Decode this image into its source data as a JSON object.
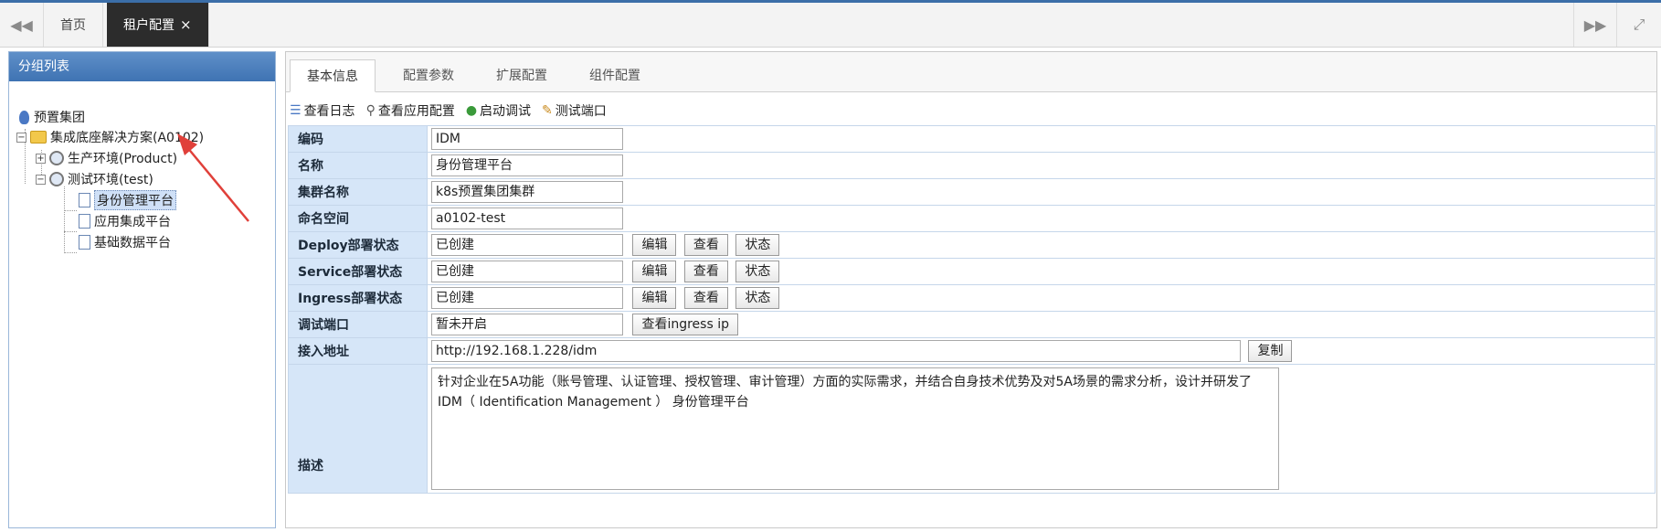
{
  "topbar": {
    "tabs": [
      {
        "label": "首页"
      },
      {
        "label": "租户配置",
        "close": "×"
      }
    ],
    "left_nav_glyph": "◀◀",
    "right_nav_glyph": "▶▶",
    "fullscreen_glyph": "⤢"
  },
  "sidebar": {
    "title": "分组列表",
    "tree": {
      "root": "预置集团",
      "solution": "集成底座解决方案(A0102)",
      "env_product": "生产环境(Product)",
      "env_test": "测试环境(test)",
      "apps": [
        "身份管理平台",
        "应用集成平台",
        "基础数据平台"
      ]
    }
  },
  "content": {
    "tabs": [
      "基本信息",
      "配置参数",
      "扩展配置",
      "组件配置"
    ],
    "toolbar": [
      "查看日志",
      "查看应用配置",
      "启动调试",
      "测试端口"
    ],
    "fields": {
      "code": {
        "label": "编码",
        "value": "IDM"
      },
      "name": {
        "label": "名称",
        "value": "身份管理平台"
      },
      "cluster": {
        "label": "集群名称",
        "value": "k8s预置集团集群"
      },
      "namespace": {
        "label": "命名空间",
        "value": "a0102-test"
      },
      "deploy": {
        "label": "Deploy部署状态",
        "value": "已创建"
      },
      "service": {
        "label": "Service部署状态",
        "value": "已创建"
      },
      "ingress": {
        "label": "Ingress部署状态",
        "value": "已创建"
      },
      "debug_port": {
        "label": "调试端口",
        "value": "暂未开启",
        "button": "查看ingress ip"
      },
      "access_url": {
        "label": "接入地址",
        "value": "http://192.168.1.228/idm",
        "button": "复制"
      },
      "description": {
        "label": "描述",
        "value": "针对企业在5A功能（账号管理、认证管理、授权管理、审计管理）方面的实际需求，并结合自身技术优势及对5A场景的需求分析，设计并研发了IDM（ Identification Management ） 身份管理平台"
      }
    },
    "status_buttons": {
      "edit": "编辑",
      "view": "查看",
      "status": "状态"
    }
  },
  "colors": {
    "accent": "#3b6ea8",
    "label_bg": "#d6e6f8",
    "active_tab": "#2c2c2c",
    "arrow": "#e0403a"
  }
}
